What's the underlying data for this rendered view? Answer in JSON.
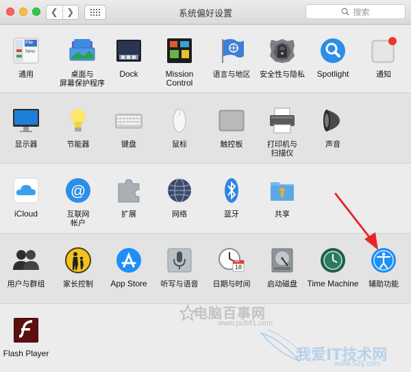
{
  "window": {
    "title": "系统偏好设置"
  },
  "search": {
    "placeholder": "搜索"
  },
  "rows": [
    {
      "items": [
        {
          "label": "通用",
          "icon": "general-icon"
        },
        {
          "label": "桌面与\n屏幕保护程序",
          "icon": "desktop-screensaver-icon"
        },
        {
          "label": "Dock",
          "icon": "dock-icon"
        },
        {
          "label": "Mission\nControl",
          "icon": "mission-control-icon"
        },
        {
          "label": "语言与地区",
          "icon": "language-region-icon"
        },
        {
          "label": "安全性与隐私",
          "icon": "security-privacy-icon"
        },
        {
          "label": "Spotlight",
          "icon": "spotlight-icon"
        },
        {
          "label": "通知",
          "icon": "notifications-icon"
        }
      ]
    },
    {
      "items": [
        {
          "label": "显示器",
          "icon": "displays-icon"
        },
        {
          "label": "节能器",
          "icon": "energy-saver-icon"
        },
        {
          "label": "键盘",
          "icon": "keyboard-icon"
        },
        {
          "label": "鼠标",
          "icon": "mouse-icon"
        },
        {
          "label": "触控板",
          "icon": "trackpad-icon"
        },
        {
          "label": "打印机与\n扫描仪",
          "icon": "printers-scanners-icon"
        },
        {
          "label": "声音",
          "icon": "sound-icon"
        }
      ]
    },
    {
      "items": [
        {
          "label": "iCloud",
          "icon": "icloud-icon"
        },
        {
          "label": "互联网\n帐户",
          "icon": "internet-accounts-icon"
        },
        {
          "label": "扩展",
          "icon": "extensions-icon"
        },
        {
          "label": "网络",
          "icon": "network-icon"
        },
        {
          "label": "蓝牙",
          "icon": "bluetooth-icon"
        },
        {
          "label": "共享",
          "icon": "sharing-icon"
        }
      ]
    },
    {
      "items": [
        {
          "label": "用户与群组",
          "icon": "users-groups-icon"
        },
        {
          "label": "家长控制",
          "icon": "parental-controls-icon"
        },
        {
          "label": "App Store",
          "icon": "app-store-icon"
        },
        {
          "label": "听写与语音",
          "icon": "dictation-speech-icon"
        },
        {
          "label": "日期与时间",
          "icon": "date-time-icon"
        },
        {
          "label": "启动磁盘",
          "icon": "startup-disk-icon"
        },
        {
          "label": "Time Machine",
          "icon": "time-machine-icon"
        },
        {
          "label": "辅助功能",
          "icon": "accessibility-icon"
        }
      ]
    },
    {
      "items": [
        {
          "label": "Flash Player",
          "icon": "flash-player-icon"
        }
      ]
    }
  ],
  "icon_texts": {
    "general_file": "File",
    "general_new": "New",
    "calendar_month": "JUL",
    "calendar_day": "18"
  },
  "watermarks": {
    "primary": "电脑百事网",
    "primary_url": "www.pc841.com",
    "secondary": "我爱IT技术网",
    "secondary_url": "www.52ij.com"
  },
  "colors": {
    "accent_blue": "#1e8ff5",
    "annotation_red": "#e8262a",
    "notification_dot": "#f0342b"
  }
}
